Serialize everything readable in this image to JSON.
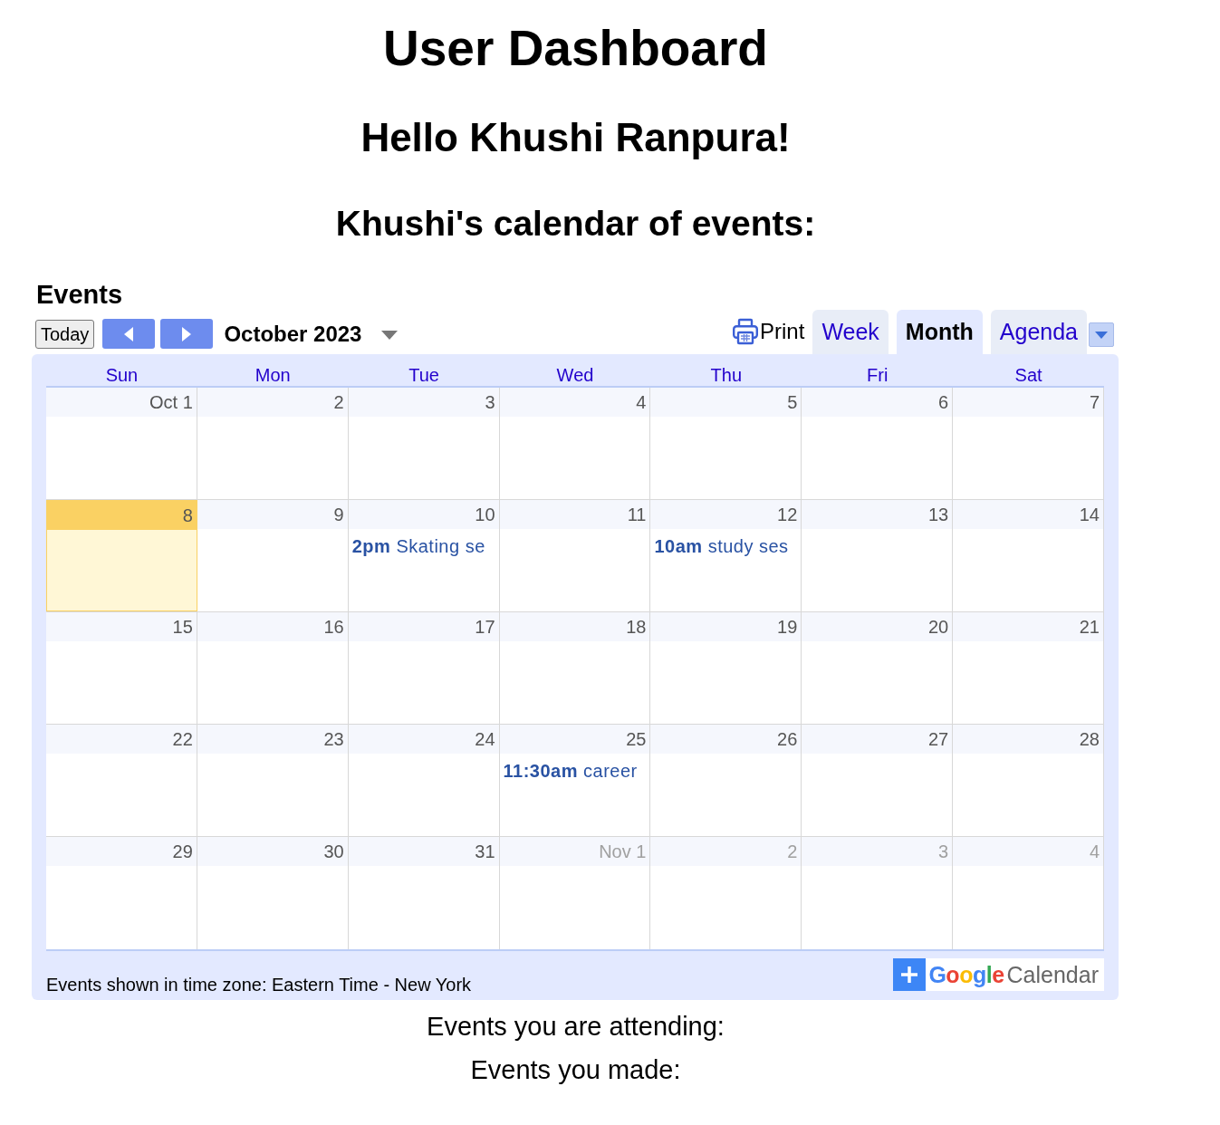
{
  "page": {
    "title": "User Dashboard",
    "greeting": "Hello Khushi Ranpura!",
    "subtitle": "Khushi's calendar of events:"
  },
  "calendar": {
    "title": "Events",
    "toolbar": {
      "today_button": "Today",
      "period": "October 2023",
      "print": "Print",
      "tabs": [
        {
          "label": "Week",
          "selected": false
        },
        {
          "label": "Month",
          "selected": true
        },
        {
          "label": "Agenda",
          "selected": false
        }
      ]
    },
    "weekdays": [
      "Sun",
      "Mon",
      "Tue",
      "Wed",
      "Thu",
      "Fri",
      "Sat"
    ],
    "weeks": [
      [
        {
          "date": "Oct 1",
          "in_month": true,
          "today": false
        },
        {
          "date": "2",
          "in_month": true,
          "today": false
        },
        {
          "date": "3",
          "in_month": true,
          "today": false
        },
        {
          "date": "4",
          "in_month": true,
          "today": false
        },
        {
          "date": "5",
          "in_month": true,
          "today": false
        },
        {
          "date": "6",
          "in_month": true,
          "today": false
        },
        {
          "date": "7",
          "in_month": true,
          "today": false
        }
      ],
      [
        {
          "date": "8",
          "in_month": true,
          "today": true
        },
        {
          "date": "9",
          "in_month": true,
          "today": false
        },
        {
          "date": "10",
          "in_month": true,
          "today": false,
          "events": [
            "**2pm** Skating se"
          ]
        },
        {
          "date": "11",
          "in_month": true,
          "today": false
        },
        {
          "date": "12",
          "in_month": true,
          "today": false,
          "events": [
            "**10am** study ses"
          ]
        },
        {
          "date": "13",
          "in_month": true,
          "today": false
        },
        {
          "date": "14",
          "in_month": true,
          "today": false
        }
      ],
      [
        {
          "date": "15",
          "in_month": true,
          "today": false
        },
        {
          "date": "16",
          "in_month": true,
          "today": false
        },
        {
          "date": "17",
          "in_month": true,
          "today": false
        },
        {
          "date": "18",
          "in_month": true,
          "today": false
        },
        {
          "date": "19",
          "in_month": true,
          "today": false
        },
        {
          "date": "20",
          "in_month": true,
          "today": false
        },
        {
          "date": "21",
          "in_month": true,
          "today": false
        }
      ],
      [
        {
          "date": "22",
          "in_month": true,
          "today": false
        },
        {
          "date": "23",
          "in_month": true,
          "today": false
        },
        {
          "date": "24",
          "in_month": true,
          "today": false
        },
        {
          "date": "25",
          "in_month": true,
          "today": false,
          "events": [
            "**11:30am** career"
          ]
        },
        {
          "date": "26",
          "in_month": true,
          "today": false
        },
        {
          "date": "27",
          "in_month": true,
          "today": false
        },
        {
          "date": "28",
          "in_month": true,
          "today": false
        }
      ],
      [
        {
          "date": "29",
          "in_month": true,
          "today": false
        },
        {
          "date": "30",
          "in_month": true,
          "today": false
        },
        {
          "date": "31",
          "in_month": true,
          "today": false
        },
        {
          "date": "Nov 1",
          "in_month": false,
          "today": false
        },
        {
          "date": "2",
          "in_month": false,
          "today": false
        },
        {
          "date": "3",
          "in_month": false,
          "today": false
        },
        {
          "date": "4",
          "in_month": false,
          "today": false
        }
      ]
    ],
    "timezone_note": "Events shown in time zone: Eastern Time - New York",
    "badge": {
      "brand": "Google",
      "label": "Calendar"
    }
  },
  "sections": [
    "Events you are attending:",
    "Events you made:"
  ]
}
